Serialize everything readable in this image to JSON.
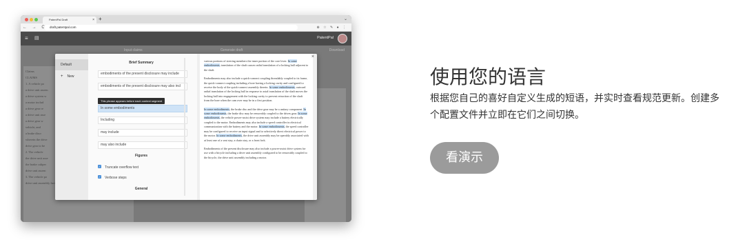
{
  "browser": {
    "tab_title": "PatentPal Draft",
    "tab_close": "×",
    "new_tab": "+",
    "url": "draft.patentpal.com",
    "nav_glyphs": "← → C",
    "icons": "⊕ ☆ ✎ ● ⋮"
  },
  "app": {
    "brand": "PatentPal",
    "steps": {
      "input": "Input claims",
      "generate": "Generate draft",
      "download": "Download"
    }
  },
  "background_doc": {
    "heading": "Claims",
    "lines": [
      "CLAIMS",
      "1.  A vehicle po",
      "a drive unit assem",
      "a drive system w",
      "a motor includ",
      "a drive gear re",
      "a drive unit asse",
      "a drive gear w",
      "vehicle; and",
      "a brake discr",
      "wherein the drive",
      "drive gear to be",
      "2.  The vehicle",
      "the drive unit asse",
      "the brake caliper",
      "drive unit assem",
      "3. The vehicle po",
      "drive unit assembly further comprises:"
    ]
  },
  "modal": {
    "close": "×",
    "profiles": {
      "default": "Default",
      "new": "New",
      "new_icon": "+"
    },
    "brief_summary_title": "Brief Summary",
    "fields": [
      "embodiments of the present disclosure may include",
      "embodiments of the present disclosure may also incl",
      "In some embodiments",
      "Including",
      "may include",
      "may also include"
    ],
    "tooltip": "This phrase appears before each context segment",
    "figures_title": "Figures",
    "checks": [
      "Truncate overflow text",
      "Verbose steps"
    ],
    "general_title": "General",
    "preview": [
      {
        "parts": [
          [
            "t",
            "various portions of steering members the inner portion of the "
          ],
          [
            "t",
            "core lever. "
          ],
          [
            "m",
            "In some embodiments"
          ],
          [
            "t",
            ", translation of the shaft causes radial translation of a locking ball adjacent to the shaft."
          ]
        ]
      },
      {
        "parts": [
          [
            "t",
            "Embodiments may also include a quick-connect coupling threadably coupled to its frame, the quick-connect coupling including a bore having a locking cavity and configured to receive the body of the quick-connect assembly therein. "
          ],
          [
            "m",
            "In some embodiments"
          ],
          [
            "t",
            ", outward radial translation of the locking ball in response to axial translation of the shaft moves the locking ball into engagement with the locking cavity to prevent retraction of the shaft from the bore when the cam over may be in a first position."
          ]
        ]
      },
      {
        "parts": [
          [
            "m",
            "In some embodiments"
          ],
          [
            "t",
            ", the brake disc and the drive gear may be a unitary component. "
          ],
          [
            "m",
            "In some embodiments"
          ],
          [
            "t",
            ", the brake disc may be removably coupled to the drives gear. "
          ],
          [
            "m",
            "In some embodiments"
          ],
          [
            "t",
            ", the vehicle power-assist drive system may include a battery electrically coupled to the motor. Embodiments may also include a speed controller in electrical communication with the battery and the motor. "
          ],
          [
            "m",
            "In some embodiments"
          ],
          [
            "t",
            ", the speed controller may be configured to receive an input signal and to selectively direct electrical power to the motor. "
          ],
          [
            "m",
            "In some embodiments"
          ],
          [
            "t",
            ", the drive unit assembly may be operably associated with at least one of a seat stay, a chain stay, or a front fork."
          ]
        ]
      },
      {
        "parts": [
          [
            "t",
            "Embodiments of the present disclosure may also include a power-assist drive system for use with a bicycle including a drive unit assembly configured to be removably coupled to the bicycle, the drive unit assembly including a motor."
          ]
        ]
      }
    ]
  },
  "right_panel": {
    "title": "使用您的语言",
    "description": "根据您自己的喜好自定义生成的短语，并实时查看规范更新。创建多个配置文件并立即在它们之间切换。",
    "button": "看演示"
  }
}
